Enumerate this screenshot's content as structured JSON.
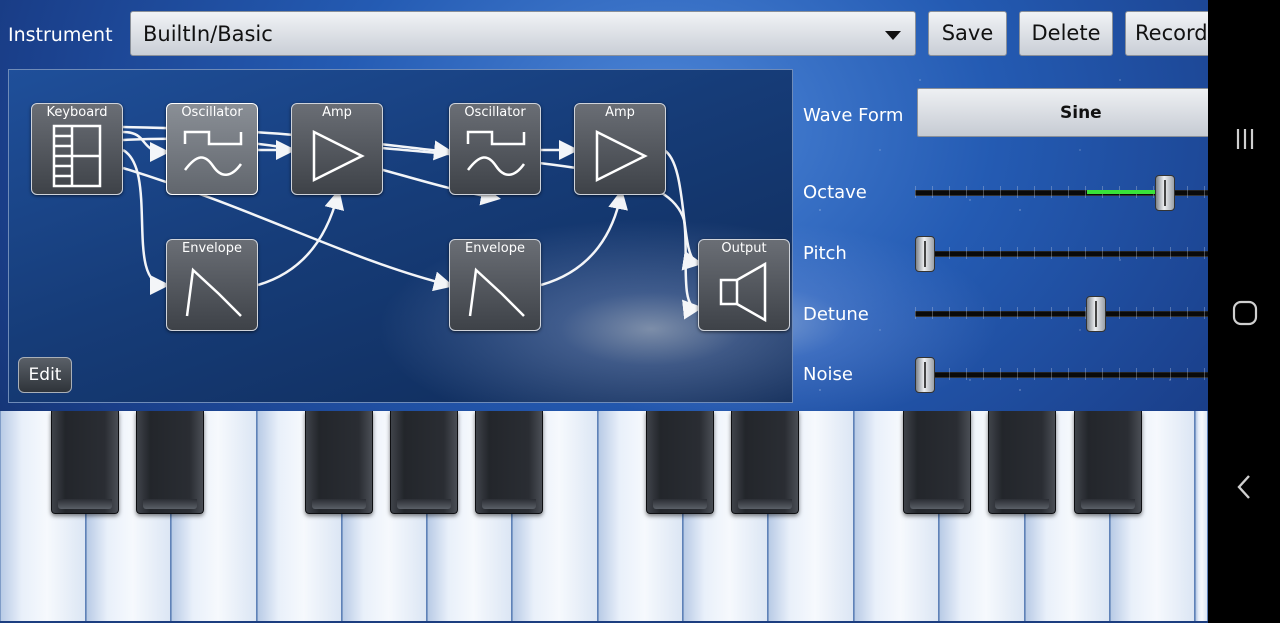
{
  "topbar": {
    "instrument_label": "Instrument",
    "instrument_value": "BuiltIn/Basic",
    "save_label": "Save",
    "delete_label": "Delete",
    "record_label": "Record"
  },
  "patch": {
    "nodes": {
      "keyboard": "Keyboard",
      "oscillator1": "Oscillator",
      "amp1": "Amp",
      "envelope1": "Envelope",
      "oscillator2": "Oscillator",
      "amp2": "Amp",
      "envelope2": "Envelope",
      "output": "Output"
    },
    "edit_label": "Edit"
  },
  "params": {
    "waveform_label": "Wave Form",
    "waveform_value": "Sine",
    "octave_label": "Octave",
    "pitch_label": "Pitch",
    "detune_label": "Detune",
    "noise_label": "Noise",
    "octave_level": 0.8,
    "pitch_level": 0.0,
    "detune_level": 0.57,
    "noise_level": 0.0,
    "octave_fill_color": "#39e23a"
  },
  "navbar": {
    "icons": [
      "recent-apps-icon",
      "home-icon",
      "back-icon"
    ]
  }
}
